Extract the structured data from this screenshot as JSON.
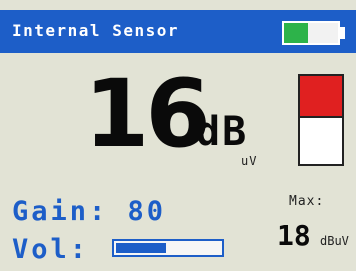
{
  "header": {
    "title": "Internal Sensor"
  },
  "battery": {
    "level": 0.45,
    "fill_color": "#2db34a"
  },
  "measurement": {
    "value": "16",
    "unit": "dB",
    "sub_unit": "uV"
  },
  "level_indicator": {
    "fill_fraction": 0.45,
    "color": "#e02020"
  },
  "gain": {
    "text": "Gain: 80"
  },
  "volume": {
    "label": "Vol:",
    "level": 0.5
  },
  "max": {
    "label": "Max:",
    "value": "18",
    "unit": "dBuV"
  },
  "colors": {
    "accent": "#1d5ec8",
    "background": "#e2e3d5"
  }
}
